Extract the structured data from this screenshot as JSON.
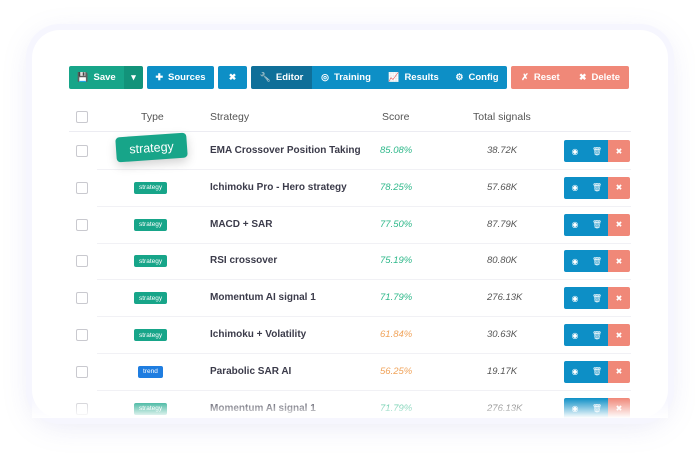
{
  "toolbar": {
    "save": "Save",
    "sources": "Sources",
    "editor": "Editor",
    "training": "Training",
    "results": "Results",
    "config": "Config",
    "reset": "Reset",
    "delete": "Delete"
  },
  "table": {
    "headers": {
      "type": "Type",
      "strategy": "Strategy",
      "score": "Score",
      "signals": "Total signals"
    },
    "rows": [
      {
        "type": "strategy",
        "name": "EMA Crossover Position Taking",
        "score": "85.08%",
        "signals": "38.72K",
        "score_color": "#2eb88a"
      },
      {
        "type": "strategy",
        "name": "Ichimoku Pro - Hero strategy",
        "score": "78.25%",
        "signals": "57.68K",
        "score_color": "#2eb88a"
      },
      {
        "type": "strategy",
        "name": "MACD + SAR",
        "score": "77.50%",
        "signals": "87.79K",
        "score_color": "#2eb88a"
      },
      {
        "type": "strategy",
        "name": "RSI crossover",
        "score": "75.19%",
        "signals": "80.80K",
        "score_color": "#2eb88a"
      },
      {
        "type": "strategy",
        "name": "Momentum AI signal 1",
        "score": "71.79%",
        "signals": "276.13K",
        "score_color": "#2eb88a"
      },
      {
        "type": "strategy",
        "name": "Ichimoku + Volatility",
        "score": "61.84%",
        "signals": "30.63K",
        "score_color": "#f0a35a"
      },
      {
        "type": "trend",
        "name": "Parabolic SAR AI",
        "score": "56.25%",
        "signals": "19.17K",
        "score_color": "#f0a35a"
      },
      {
        "type": "strategy",
        "name": "Momentum AI signal 1",
        "score": "71.79%",
        "signals": "276.13K",
        "score_color": "#2eb88a"
      }
    ]
  },
  "tooltip_badge": "strategy"
}
